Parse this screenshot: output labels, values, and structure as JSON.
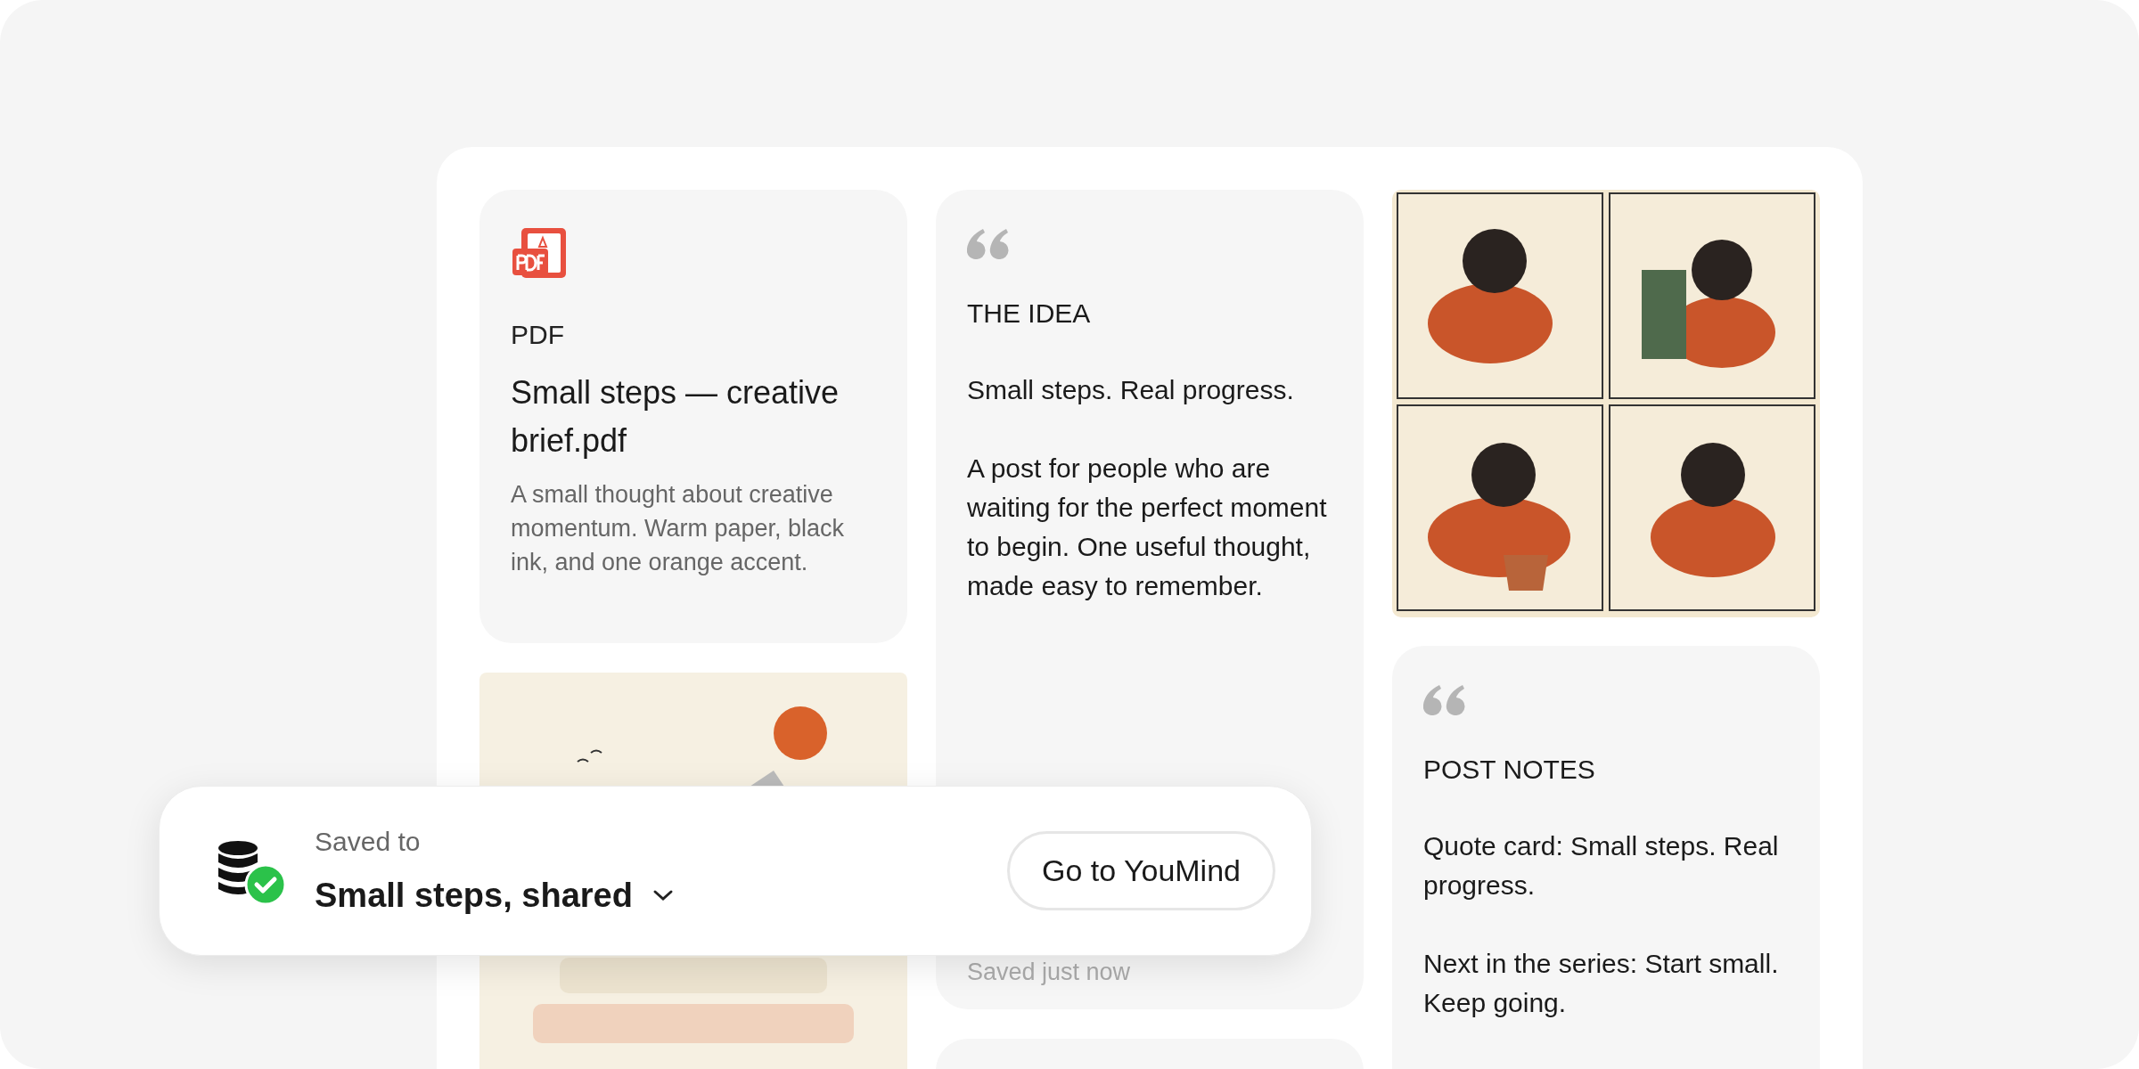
{
  "file_card": {
    "type_label": "PDF",
    "title": "Small steps — creative brief.pdf",
    "description": "A small thought about creative momentum. Warm paper, black ink, and one orange accent."
  },
  "idea_card": {
    "heading": "THE IDEA",
    "paragraphs": [
      "Small steps. Real progress.",
      "A post for people who are waiting for the perfect moment to begin. One useful thought, made easy to remember."
    ],
    "footer": "Saved just now"
  },
  "notes_card": {
    "heading": "POST NOTES",
    "paragraphs": [
      "Quote card: Small steps. Real progress.",
      "Next in the series: Start small. Keep going."
    ]
  },
  "toast": {
    "label": "Saved to",
    "destination": "Small steps, shared",
    "button": "Go to YouMind"
  }
}
